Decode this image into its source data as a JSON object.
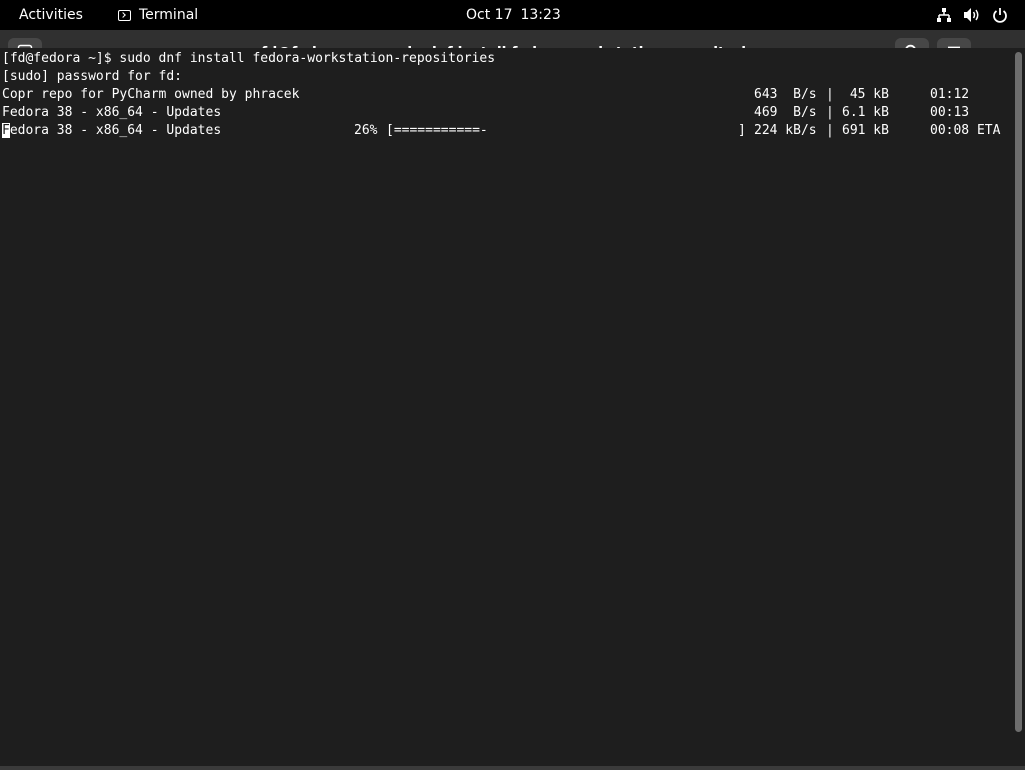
{
  "topbar": {
    "activities": "Activities",
    "app_name": "Terminal",
    "app_icon": "terminal-icon",
    "date": "Oct 17",
    "time": "13:23",
    "tray_icons": [
      "network-icon",
      "volume-icon",
      "power-icon"
    ]
  },
  "window": {
    "title": "fd@fedora:~ — sudo dnf install fedora-workstation-repositories",
    "buttons": [
      "new-tab-icon",
      "search-icon",
      "hamburger-menu-icon",
      "close-icon"
    ],
    "close_label": "×"
  },
  "terminal": {
    "prompt_line": "[fd@fedora ~]$ sudo dnf install fedora-workstation-repositories",
    "sudo_prompt": "[sudo] password for fd:",
    "repos": [
      {
        "name": "Copr repo for PyCharm owned by phracek",
        "rate": "643  B/s",
        "size": " 45 kB",
        "time": "01:12"
      },
      {
        "name": "Fedora 38 - x86_64 - Updates",
        "rate": "469  B/s",
        "size": "6.1 kB",
        "time": "00:13"
      }
    ],
    "progress": {
      "cursor_char": "F",
      "name_rest": "edora 38 - x86_64 - Updates",
      "percent": "26%",
      "bar": "[===========-",
      "bar_close": "]",
      "rate": "224 kB/s",
      "size": "691 kB",
      "time": "00:08 ETA",
      "fraction": 0.26
    },
    "separator": "|"
  },
  "colors": {
    "topbar_bg": "#000000",
    "headerbar_bg": "#303030",
    "terminal_bg": "#1e1e1e",
    "terminal_fg": "#ffffff"
  }
}
